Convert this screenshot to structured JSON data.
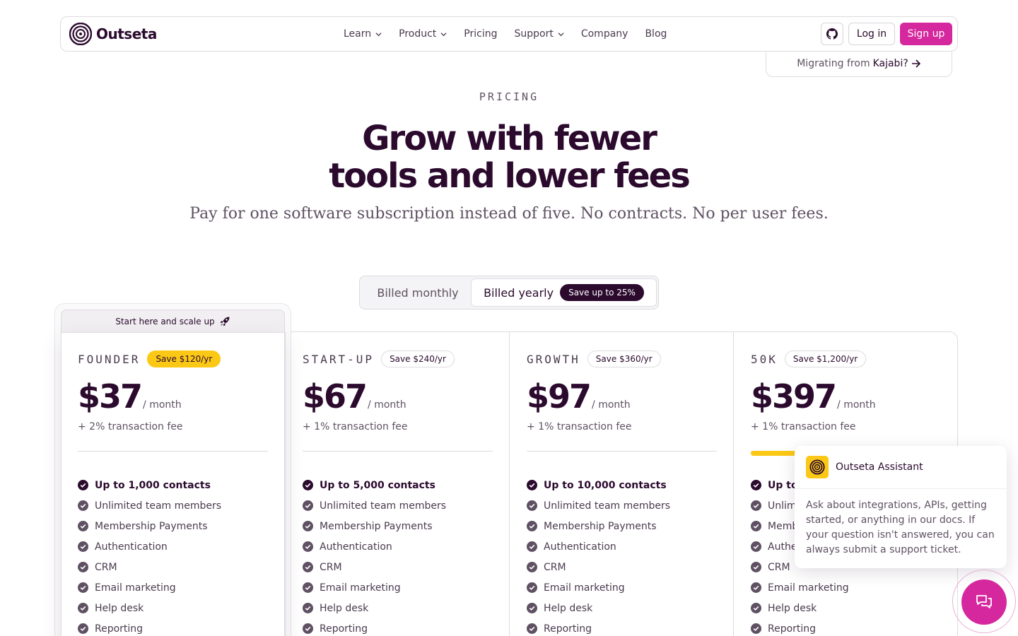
{
  "brand": {
    "name": "Outseta",
    "accent": "#d6289e",
    "dark": "#2b0a2e",
    "highlight": "#fbc815"
  },
  "nav": {
    "links": [
      {
        "label": "Learn",
        "dropdown": true
      },
      {
        "label": "Product",
        "dropdown": true
      },
      {
        "label": "Pricing",
        "dropdown": false
      },
      {
        "label": "Support",
        "dropdown": true
      },
      {
        "label": "Company",
        "dropdown": false
      },
      {
        "label": "Blog",
        "dropdown": false
      }
    ],
    "github_icon": "github-icon",
    "login_label": "Log in",
    "signup_label": "Sign up"
  },
  "migrate": {
    "prefix": "Migrating from",
    "target": "Kajabi?"
  },
  "hero": {
    "eyebrow": "PRICING",
    "headline_line1": "Grow with fewer",
    "headline_line2": "tools and lower fees",
    "subhead": "Pay for one software subscription instead of five. No contracts. No per user fees."
  },
  "billing": {
    "monthly_label": "Billed monthly",
    "yearly_label": "Billed yearly",
    "yearly_badge": "Save up to 25%",
    "selected": "yearly"
  },
  "featured_banner": "Start here and scale up",
  "plans": [
    {
      "name": "FOUNDER",
      "save": "Save $120/yr",
      "price": "$37",
      "per": "/ month",
      "fee": "+ 2% transaction fee",
      "features": [
        "Up to 1,000 contacts",
        "Unlimited team members",
        "Membership Payments",
        "Authentication",
        "CRM",
        "Email marketing",
        "Help desk",
        "Reporting"
      ]
    },
    {
      "name": "START-UP",
      "save": "Save $240/yr",
      "price": "$67",
      "per": "/ month",
      "fee": "+ 1% transaction fee",
      "features": [
        "Up to 5,000 contacts",
        "Unlimited team members",
        "Membership Payments",
        "Authentication",
        "CRM",
        "Email marketing",
        "Help desk",
        "Reporting"
      ]
    },
    {
      "name": "GROWTH",
      "save": "Save $360/yr",
      "price": "$97",
      "per": "/ month",
      "fee": "+ 1% transaction fee",
      "features": [
        "Up to 10,000 contacts",
        "Unlimited team members",
        "Membership Payments",
        "Authentication",
        "CRM",
        "Email marketing",
        "Help desk",
        "Reporting"
      ]
    },
    {
      "name": "50K",
      "save": "Save $1,200/yr",
      "price": "$397",
      "per": "/ month",
      "fee": "+ 1% transaction fee",
      "features": [
        "Up to",
        "Unlimi",
        "Memb",
        "Authe",
        "CRM",
        "Email marketing",
        "Help desk",
        "Reporting"
      ]
    }
  ],
  "assistant": {
    "title": "Outseta Assistant",
    "body": "Ask about integrations, APIs, getting started, or anything in our docs. If your question isn't answered, you can always submit a support ticket."
  }
}
